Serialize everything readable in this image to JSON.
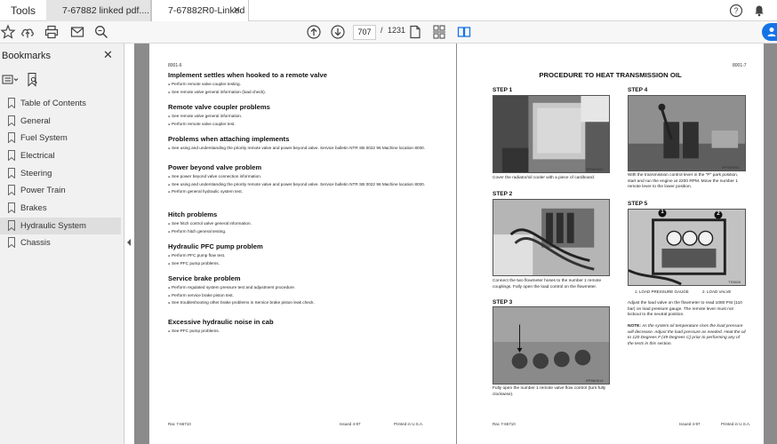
{
  "tabs": {
    "home": "Tools",
    "tab1": "7-67882 linked pdf....",
    "tab2": "7-67882R0-Linked ..."
  },
  "toolbar": {
    "current_page": "707",
    "separator": "/",
    "total_pages": "1231"
  },
  "sidebar": {
    "title": "Bookmarks",
    "items": [
      {
        "label": "Table of Contents"
      },
      {
        "label": "General"
      },
      {
        "label": "Fuel System"
      },
      {
        "label": "Electrical"
      },
      {
        "label": "Steering"
      },
      {
        "label": "Power Train"
      },
      {
        "label": "Brakes"
      },
      {
        "label": "Hydraulic System",
        "selected": true
      },
      {
        "label": "Chassis"
      }
    ]
  },
  "left_page": {
    "header": "8001-6",
    "sections": [
      {
        "title": "Implement settles when hooked to a remote valve",
        "items": [
          "Perform remote valve coupler testing.",
          "See remote valve general information (load check)."
        ]
      },
      {
        "title": "Remote valve coupler problems",
        "items": [
          "See remote valve general information.",
          "Perform remote valve coupler test."
        ]
      },
      {
        "title": "Problems when attaching implements",
        "items": [
          "See using and understanding the priority remote valve and power beyond valve. Service bulletin NTR SB 0022 96 Machine location 8030."
        ]
      },
      {
        "title": "Power beyond valve problem",
        "items": [
          "See power beyond valve connection information.",
          "See using and understanding the priority remote valve and power beyond valve. Service bulletin NTR SB 0022 96 Machine location 8030.",
          "Perform general hydraulic system test."
        ]
      },
      {
        "title": "Hitch problems",
        "items": [
          "See hitch control valve general information.",
          "Perform hitch general testing."
        ]
      },
      {
        "title": "Hydraulic PFC pump problem",
        "items": [
          "Perform PFC pump flow test.",
          "See PFC pump problems."
        ]
      },
      {
        "title": "Service brake problem",
        "items": [
          "Perform regulated system pressure test and adjustment procedure.",
          "Perform service brake piston test.",
          "See troubleshooting other brake problems in Service brake piston leak check."
        ]
      },
      {
        "title": "Excessive hydraulic noise in cab",
        "items": [
          "See PFC pump problems."
        ]
      }
    ],
    "footer_left": "Rac 7-66710",
    "footer_mid": "Issued 4-97",
    "footer_right": "Printed in U.S.A."
  },
  "right_page": {
    "header": "8001-7",
    "title": "PROCEDURE TO HEAT TRANSMISSION OIL",
    "steps": [
      {
        "label": "STEP 1",
        "photo_id": "RP96H052",
        "caption": "Cover the radiator/oil cooler with a piece of cardboard."
      },
      {
        "label": "STEP 2",
        "photo_id": "",
        "caption": "Connect the two flowmeter hoses to the number 1 remote couplings. Fully open the load control on the flowmeter."
      },
      {
        "label": "STEP 3",
        "photo_id": "RP96H014",
        "caption": "Fully open the number 1 remote valve flow control (turn fully clockwise)."
      },
      {
        "label": "STEP 4",
        "photo_id": "RP96H054",
        "caption": "With the transmission control lever in the \"P\" park position, start and run the engine at 2200 RPM. Move the number 1 remote lever to the lower position."
      },
      {
        "label": "STEP 5",
        "photo_id": "TS3826",
        "caption": "Adjust the load valve on the flowmeter to read 1080 PSI (110 bar) on load pressure gauge. The remote lever must not kickout to the neutral position."
      }
    ],
    "legend": [
      "1.   LOAD PRESSURE GAUGE",
      "2.   LOAD VALVE"
    ],
    "callouts": [
      "1",
      "2"
    ],
    "note_label": "NOTE:",
    "note_text": "As the system oil temperature rises the load pressure will decrease. Adjust the load pressure as needed. Heat the oil to 120 Degrees F (49 Degrees C) prior to performing any of the tests in this section.",
    "footer_left": "Rac 7-66710",
    "footer_mid": "Issued 4-97",
    "footer_right": "Printed in U.S.A."
  },
  "colors": {
    "accent": "#1473e6",
    "doc_background": "#8b8b8b",
    "sidebar_bg": "#f1f1f1"
  }
}
